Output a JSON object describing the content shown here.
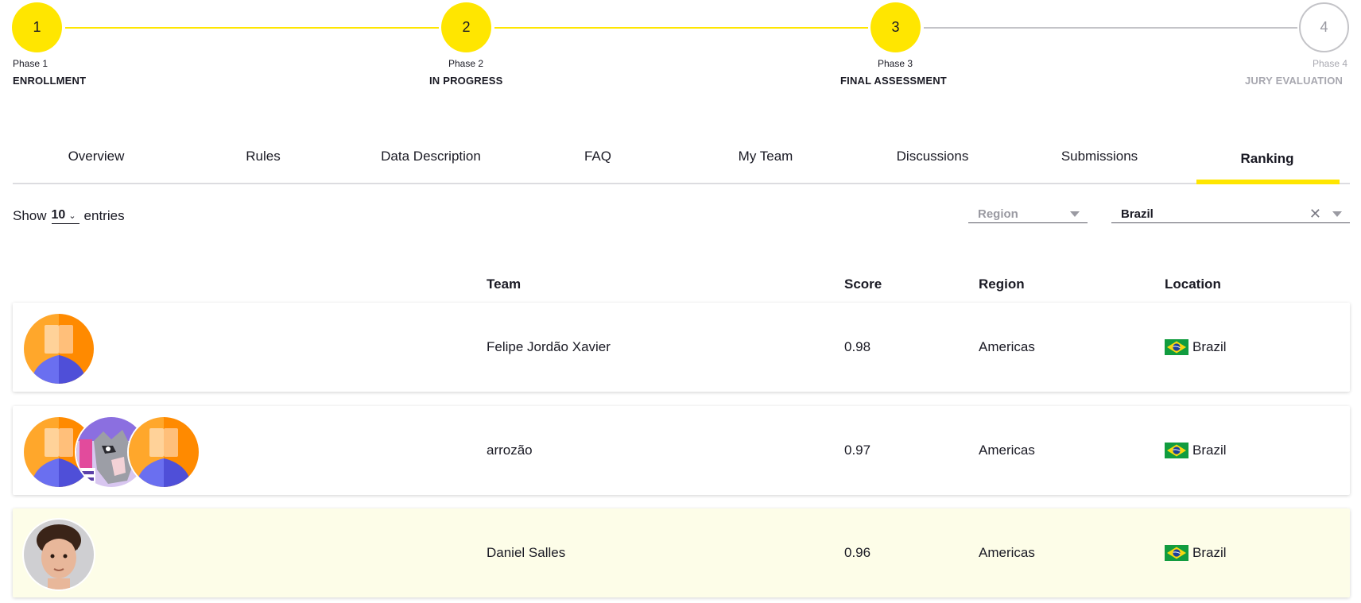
{
  "stepper": {
    "steps": [
      {
        "number": "1",
        "phase": "Phase 1",
        "name": "ENROLLMENT",
        "state": "done"
      },
      {
        "number": "2",
        "phase": "Phase 2",
        "name": "IN PROGRESS",
        "state": "done"
      },
      {
        "number": "3",
        "phase": "Phase 3",
        "name": "FINAL ASSESSMENT",
        "state": "current"
      },
      {
        "number": "4",
        "phase": "Phase 4",
        "name": "JURY EVALUATION",
        "state": "upcoming"
      }
    ]
  },
  "tabs": [
    {
      "label": "Overview"
    },
    {
      "label": "Rules"
    },
    {
      "label": "Data Description"
    },
    {
      "label": "FAQ"
    },
    {
      "label": "My Team"
    },
    {
      "label": "Discussions"
    },
    {
      "label": "Submissions"
    },
    {
      "label": "Ranking",
      "active": true
    }
  ],
  "controls": {
    "show_label": "Show",
    "entries_value": "10",
    "entries_label": "entries",
    "region_placeholder": "Region",
    "country_value": "Brazil"
  },
  "table": {
    "headers": {
      "team": "Team",
      "score": "Score",
      "region": "Region",
      "location": "Location"
    },
    "rows": [
      {
        "team": "Felipe Jordão Xavier",
        "score": "0.98",
        "region": "Americas",
        "location": "Brazil",
        "avatars": [
          "default-avatar"
        ]
      },
      {
        "team": "arrozão",
        "score": "0.97",
        "region": "Americas",
        "location": "Brazil",
        "avatars": [
          "default-avatar",
          "cat-photo-avatar",
          "default-avatar"
        ]
      },
      {
        "team": "Daniel Salles",
        "score": "0.96",
        "region": "Americas",
        "location": "Brazil",
        "avatars": [
          "person-photo-avatar"
        ],
        "highlighted": true
      }
    ]
  },
  "colors": {
    "accent": "#ffe600",
    "inactive": "#c4c4c8",
    "text": "#1a1a24",
    "highlight_row": "#fdfde8"
  }
}
